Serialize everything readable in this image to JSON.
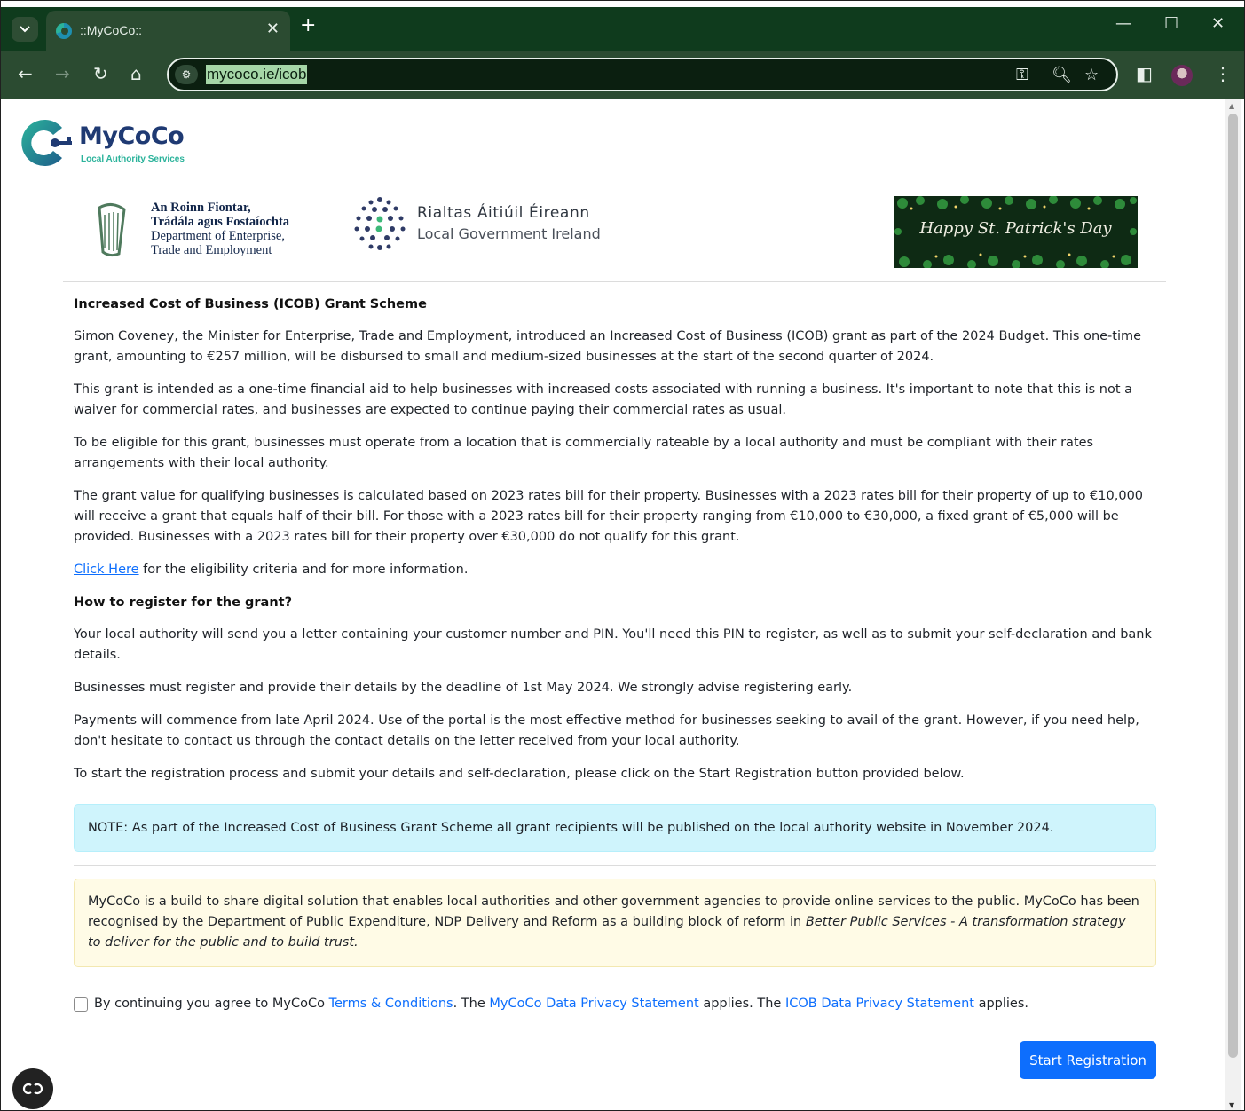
{
  "browser": {
    "tab_title": "::MyCoCo::",
    "url": "mycoco.ie/icob"
  },
  "header": {
    "logo_name": "MyCoCo",
    "logo_tagline": "Local Authority Services",
    "dept_logo": {
      "line1": "An Roinn Fiontar,",
      "line2": "Trádála agus Fostaíochta",
      "line3": "Department of Enterprise,",
      "line4": "Trade and Employment"
    },
    "lgi_logo": {
      "title": "Rialtas Áitiúil Éireann",
      "subtitle": "Local Government Ireland"
    },
    "banner_text": "Happy St. Patrick's Day"
  },
  "content": {
    "heading": "Increased Cost of Business (ICOB) Grant Scheme",
    "p1": "Simon Coveney, the Minister for Enterprise, Trade and Employment, introduced an Increased Cost of Business (ICOB) grant as part of the 2024 Budget. This one-time grant, amounting to €257 million, will be disbursed to small and medium-sized businesses at the start of the second quarter of 2024.",
    "p2": "This grant is intended as a one-time financial aid to help businesses with increased costs associated with running a business. It's important to note that this is not a waiver for commercial rates, and businesses are expected to continue paying their commercial rates as usual.",
    "p3": "To be eligible for this grant, businesses must operate from a location that is commercially rateable by a local authority and must be compliant with their rates arrangements with their local authority.",
    "p4": "The grant value for qualifying businesses is calculated based on 2023 rates bill for their property. Businesses with a 2023 rates bill for their property of up to €10,000 will receive a grant that equals half of their bill. For those with a 2023 rates bill for their property ranging from €10,000 to €30,000, a fixed grant of €5,000 will be provided. Businesses with a 2023 rates bill for their property over €30,000 do not qualify for this grant.",
    "click_here_link": "Click Here",
    "click_here_rest": " for the eligibility criteria and for more information.",
    "heading2": "How to register for the grant?",
    "p5": "Your local authority will send you a letter containing your customer number and PIN. You'll need this PIN to register, as well as to submit your self-declaration and bank details.",
    "p6": "Businesses must register and provide their details by the deadline of 1st May 2024. We strongly advise registering early.",
    "p7": "Payments will commence from late April 2024. Use of the portal is the most effective method for businesses seeking to avail of the grant. However, if you need help, don't hesitate to contact us through the contact details on the letter received from your local authority.",
    "p8": "To start the registration process and submit your details and self-declaration, please click on the Start Registration button provided below."
  },
  "notes": {
    "info": "NOTE: As part of the Increased Cost of Business Grant Scheme all grant recipients will be published on the local authority website in November 2024.",
    "warn_text": "MyCoCo is a build to share digital solution that enables local authorities and other government agencies to provide online services to the public. MyCoCo has been recognised by the Department of Public Expenditure, NDP Delivery and Reform as a building block of reform in ",
    "warn_em": "Better Public Services - A transformation strategy to deliver for the public and to build trust."
  },
  "agreement": {
    "prefix": "By continuing you agree to MyCoCo ",
    "terms_link": "Terms & Conditions",
    "mid1": ". The ",
    "privacy_link": "MyCoCo Data Privacy Statement",
    "mid2": " applies. The ",
    "icob_link": "ICOB Data Privacy Statement",
    "suffix": " applies."
  },
  "actions": {
    "start_label": "Start Registration"
  },
  "colors": {
    "chrome_dark": "#0f3b1d",
    "chrome_toolbar": "#2b4b31",
    "primary": "#0d6efd",
    "info_bg": "#cff4fc",
    "warn_bg": "#fffbe6"
  }
}
